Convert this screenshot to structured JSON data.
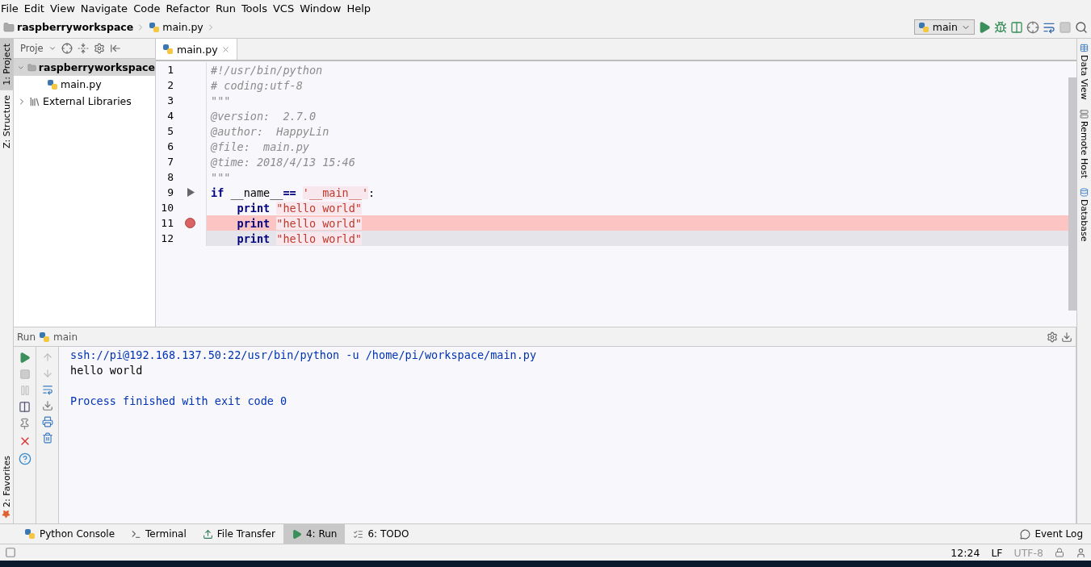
{
  "menu": [
    "File",
    "Edit",
    "View",
    "Navigate",
    "Code",
    "Refactor",
    "Run",
    "Tools",
    "VCS",
    "Window",
    "Help"
  ],
  "breadcrumbs": [
    {
      "label": "raspberryworkspace",
      "kind": "folder"
    },
    {
      "label": "main.py",
      "kind": "file"
    }
  ],
  "run_config": "main",
  "left_strip": [
    {
      "label": "1: Project",
      "selected": true
    },
    {
      "label": "Z: Structure",
      "selected": false
    }
  ],
  "favorites": "2: Favorites",
  "project_panel": {
    "title": "Proje",
    "tree": [
      {
        "label": "raspberryworkspace",
        "kind": "folder",
        "expanded": true,
        "children": [
          {
            "label": "main.py",
            "kind": "file"
          }
        ]
      },
      {
        "label": "External Libraries",
        "kind": "library",
        "expanded": false
      }
    ]
  },
  "editor_tabs": [
    {
      "label": "main.py",
      "selected": true
    }
  ],
  "lines": [
    {
      "number": "1",
      "tokens": [
        {
          "kind": "comment",
          "text": "#!/usr/bin/python"
        }
      ]
    },
    {
      "number": "2",
      "tokens": [
        {
          "kind": "comment",
          "text": "# coding:utf-8"
        }
      ]
    },
    {
      "number": "3",
      "tokens": [
        {
          "kind": "docstring",
          "text": "\"\"\""
        }
      ]
    },
    {
      "number": "4",
      "tokens": [
        {
          "kind": "docstring",
          "text": "@version:  2.7.0"
        }
      ]
    },
    {
      "number": "5",
      "tokens": [
        {
          "kind": "docstring",
          "text": "@author:  HappyLin"
        }
      ]
    },
    {
      "number": "6",
      "tokens": [
        {
          "kind": "docstring",
          "text": "@file:  main.py"
        }
      ]
    },
    {
      "number": "7",
      "tokens": [
        {
          "kind": "docstring",
          "text": "@time: 2018/4/13 15:46"
        }
      ]
    },
    {
      "number": "8",
      "tokens": [
        {
          "kind": "docstring",
          "text": "\"\"\""
        }
      ]
    },
    {
      "number": "9",
      "run_marker": true,
      "tokens": [
        {
          "kind": "keyword",
          "text": "if"
        },
        {
          "kind": "plain",
          "text": "__name__",
          "space": true
        },
        {
          "kind": "keyword",
          "text": "=="
        },
        {
          "kind": "string",
          "text": "'__main__'",
          "space": true
        },
        {
          "kind": "plain",
          "text": ":"
        }
      ]
    },
    {
      "number": "10",
      "indented": true,
      "tokens": [
        {
          "kind": "keyword",
          "text": "print"
        },
        {
          "kind": "string",
          "text": "\"hello world\"",
          "space": true
        }
      ]
    },
    {
      "number": "11",
      "indented": true,
      "breakpoint": true,
      "tokens": [
        {
          "kind": "keyword",
          "text": "print"
        },
        {
          "kind": "string",
          "text": "\"hello world\"",
          "space": true
        }
      ]
    },
    {
      "number": "12",
      "indented": true,
      "current": true,
      "tokens": [
        {
          "kind": "keyword",
          "text": "print"
        },
        {
          "kind": "string",
          "text": "\"hello world\"",
          "space": true
        }
      ]
    }
  ],
  "right_strip": [
    "Data View",
    "Remote Host",
    "Database"
  ],
  "run_panel": {
    "title": "Run",
    "config": "main",
    "output": [
      {
        "kind": "system",
        "text": "ssh://pi@192.168.137.50:22/usr/bin/python -u /home/pi/workspace/main.py"
      },
      {
        "kind": "stdout",
        "text": "hello world"
      },
      {
        "kind": "blank"
      },
      {
        "kind": "system",
        "text": "Process finished with exit code 0"
      }
    ]
  },
  "tool_tabs": [
    {
      "label": "Python Console",
      "kind": "python",
      "selected": false
    },
    {
      "label": "Terminal",
      "kind": "terminal",
      "selected": false
    },
    {
      "label": "File Transfer",
      "kind": "transfer",
      "selected": false
    },
    {
      "label": "4: Run",
      "kind": "run",
      "selected": true
    },
    {
      "label": "6: TODO",
      "kind": "todo",
      "selected": false
    }
  ],
  "event_log": "Event Log",
  "status": {
    "time": "12:24",
    "line_sep": "LF",
    "encoding": "UTF-8"
  }
}
